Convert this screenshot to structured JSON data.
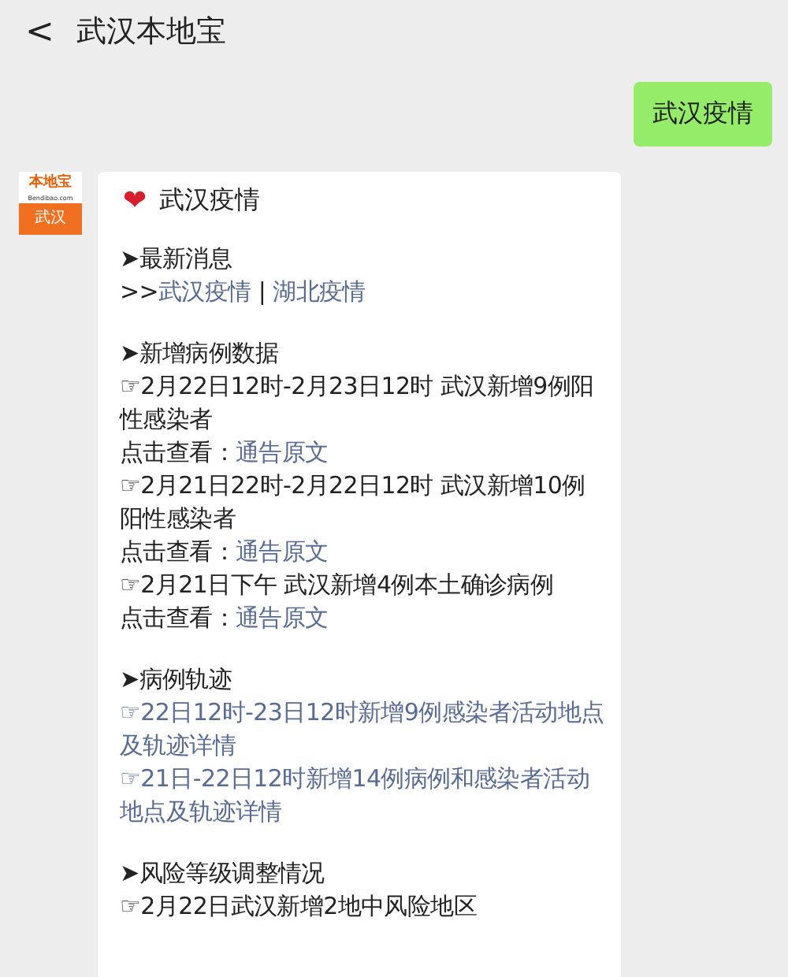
{
  "header": {
    "back": "<",
    "title": "武汉本地宝"
  },
  "messages": [
    {
      "text": "武汉疫情"
    }
  ],
  "reply": {
    "avatar": {
      "brand": "本地宝",
      "site": "Bendibao.com",
      "city": "武汉"
    },
    "title": {
      "icon": "❤",
      "text": "武汉疫情"
    },
    "sections": [
      {
        "heading": "➤最新消息",
        "paragraphs": [
          {
            "kind": "mixed",
            "parts": [
              {
                "kind": "text",
                "text": ">>"
              },
              {
                "kind": "link",
                "text": "武汉疫情"
              },
              {
                "kind": "text",
                "text": " | "
              },
              {
                "kind": "link",
                "text": "湖北疫情"
              }
            ]
          }
        ]
      },
      {
        "heading": "➤新增病例数据",
        "paragraphs": [
          {
            "kind": "plain",
            "text": "☞2月22日12时-2月23日12时 武汉新增9例阳性感染者"
          },
          {
            "kind": "mixed",
            "parts": [
              {
                "kind": "text",
                "text": "点击查看："
              },
              {
                "kind": "link",
                "text": "通告原文"
              }
            ]
          },
          {
            "kind": "plain",
            "text": "☞2月21日22时-2月22日12时 武汉新增10例阳性感染者"
          },
          {
            "kind": "mixed",
            "parts": [
              {
                "kind": "text",
                "text": "点击查看："
              },
              {
                "kind": "link",
                "text": "通告原文"
              }
            ]
          },
          {
            "kind": "plain",
            "text": "☞2月21日下午 武汉新增4例本土确诊病例"
          },
          {
            "kind": "mixed",
            "parts": [
              {
                "kind": "text",
                "text": "点击查看："
              },
              {
                "kind": "link",
                "text": "通告原文"
              }
            ]
          }
        ]
      },
      {
        "heading": "➤病例轨迹",
        "paragraphs": [
          {
            "kind": "link",
            "text": "☞22日12时-23日12时新增9例感染者活动地点及轨迹详情"
          },
          {
            "kind": "link",
            "text": "☞21日-22日12时新增14例病例和感染者活动地点及轨迹详情"
          }
        ]
      },
      {
        "heading": "➤风险等级调整情况",
        "paragraphs": [
          {
            "kind": "plain",
            "text": "☞2月22日武汉新增2地中风险地区"
          }
        ]
      }
    ]
  }
}
